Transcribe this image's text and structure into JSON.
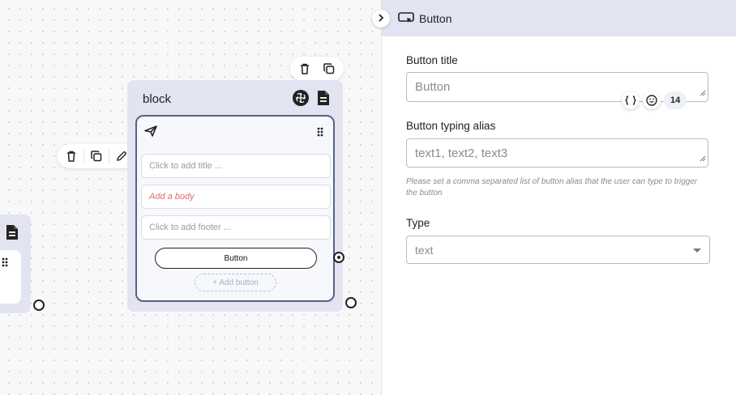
{
  "canvas": {
    "block": {
      "title": "block",
      "fields": {
        "title_placeholder": "Click to add title ...",
        "body_placeholder": "Add a body",
        "footer_placeholder": "Click to add footer ..."
      },
      "button_label": "Button",
      "add_button_label": "+ Add button"
    }
  },
  "panel": {
    "header_title": "Button",
    "button_title_label": "Button title",
    "button_title_value": "Button",
    "char_count": "14",
    "alias_label": "Button typing alias",
    "alias_placeholder": "text1, text2, text3",
    "alias_help": "Please set a comma separated list of button alias that the user can type to trigger the button",
    "type_label": "Type",
    "type_value": "text"
  },
  "colors": {
    "node_bg": "#e2e4f2",
    "card_border": "#5a6283",
    "body_placeholder": "#e26b6b",
    "panel_header": "#e2e4f2"
  }
}
